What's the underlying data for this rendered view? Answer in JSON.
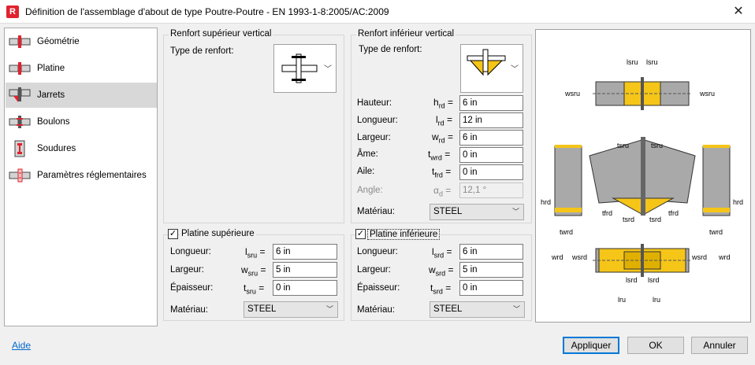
{
  "window": {
    "title": "Définition de l'assemblage d'about de type Poutre-Poutre - EN 1993-1-8:2005/AC:2009",
    "app_icon": "R"
  },
  "sidebar": {
    "items": [
      {
        "label": "Géométrie",
        "icon": "geometry-icon"
      },
      {
        "label": "Platine",
        "icon": "plate-icon"
      },
      {
        "label": "Jarrets",
        "icon": "haunch-icon"
      },
      {
        "label": "Boulons",
        "icon": "bolts-icon"
      },
      {
        "label": "Soudures",
        "icon": "welds-icon"
      },
      {
        "label": "Paramètres réglementaires",
        "icon": "code-params-icon"
      }
    ],
    "selected": "Jarrets"
  },
  "upper_stiffener": {
    "title": "Renfort supérieur vertical",
    "type_label": "Type de renfort:"
  },
  "lower_stiffener": {
    "title": "Renfort inférieur vertical",
    "type_label": "Type de renfort:",
    "rows": [
      {
        "label": "Hauteur:",
        "sym": "h",
        "sub": "rd",
        "value": "6 in"
      },
      {
        "label": "Longueur:",
        "sym": "l",
        "sub": "rd",
        "value": "12 in"
      },
      {
        "label": "Largeur:",
        "sym": "w",
        "sub": "rd",
        "value": "6 in"
      },
      {
        "label": "Âme:",
        "sym": "t",
        "sub": "wrd",
        "value": "0 in"
      },
      {
        "label": "Aile:",
        "sym": "t",
        "sub": "frd",
        "value": "0 in"
      },
      {
        "label": "Angle:",
        "sym": "α",
        "sub": "d",
        "value": "12,1 °"
      }
    ],
    "material_label": "Matériau:",
    "material": "STEEL"
  },
  "upper_plate": {
    "title": "Platine supérieure",
    "checked": true,
    "rows": [
      {
        "label": "Longueur:",
        "sym": "l",
        "sub": "sru",
        "value": "6 in"
      },
      {
        "label": "Largeur:",
        "sym": "w",
        "sub": "sru",
        "value": "5 in"
      },
      {
        "label": "Épaisseur:",
        "sym": "t",
        "sub": "sru",
        "value": "0 in"
      }
    ],
    "material_label": "Matériau:",
    "material": "STEEL"
  },
  "lower_plate": {
    "title": "Platine inférieure",
    "checked": true,
    "rows": [
      {
        "label": "Longueur:",
        "sym": "l",
        "sub": "srd",
        "value": "6 in"
      },
      {
        "label": "Largeur:",
        "sym": "w",
        "sub": "srd",
        "value": "5 in"
      },
      {
        "label": "Épaisseur:",
        "sym": "t",
        "sub": "srd",
        "value": "0 in"
      }
    ],
    "material_label": "Matériau:",
    "material": "STEEL"
  },
  "diagram": {
    "labels": [
      "lsru",
      "lsru",
      "wsru",
      "wsru",
      "tsru",
      "tsru",
      "hrd",
      "hrd",
      "tfrd",
      "tfrd",
      "tsrd",
      "tsrd",
      "twrd",
      "twrd",
      "wrd",
      "wsrd",
      "wsrd",
      "wrd",
      "lsrd",
      "lsrd",
      "lru",
      "lru"
    ]
  },
  "footer": {
    "help": "Aide",
    "apply": "Appliquer",
    "ok": "OK",
    "cancel": "Annuler"
  }
}
